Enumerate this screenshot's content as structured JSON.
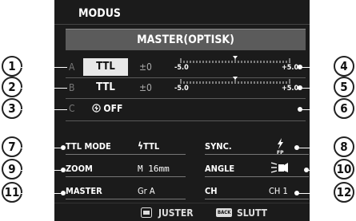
{
  "header": {
    "title": "MODUS"
  },
  "mode_bar": {
    "label": "MASTER(OPTISK)"
  },
  "groups": [
    {
      "letter": "A",
      "mode": "TTL",
      "comp": "±0",
      "scale_min": "-5.0",
      "scale_max": "+5.0"
    },
    {
      "letter": "B",
      "mode": "TTL",
      "comp": "±0",
      "scale_min": "-5.0",
      "scale_max": "+5.0"
    },
    {
      "letter": "C",
      "mode": "OFF"
    }
  ],
  "settings": {
    "ttl_mode": {
      "label": "TTL MODE",
      "value": "TTL"
    },
    "sync": {
      "label": "SYNC.",
      "value": "FP"
    },
    "zoom": {
      "label": "ZOOM",
      "value": "M 16mm"
    },
    "angle": {
      "label": "ANGLE",
      "value": ""
    },
    "master": {
      "label": "MASTER",
      "value": "Gr A"
    },
    "ch": {
      "label": "CH",
      "value": "CH 1"
    }
  },
  "footer": {
    "adjust_label": "JUSTER",
    "back_key": "BACK",
    "end_label": "SLUTT"
  },
  "callouts": [
    "1",
    "2",
    "3",
    "4",
    "5",
    "6",
    "7",
    "8",
    "9",
    "10",
    "11",
    "12"
  ]
}
